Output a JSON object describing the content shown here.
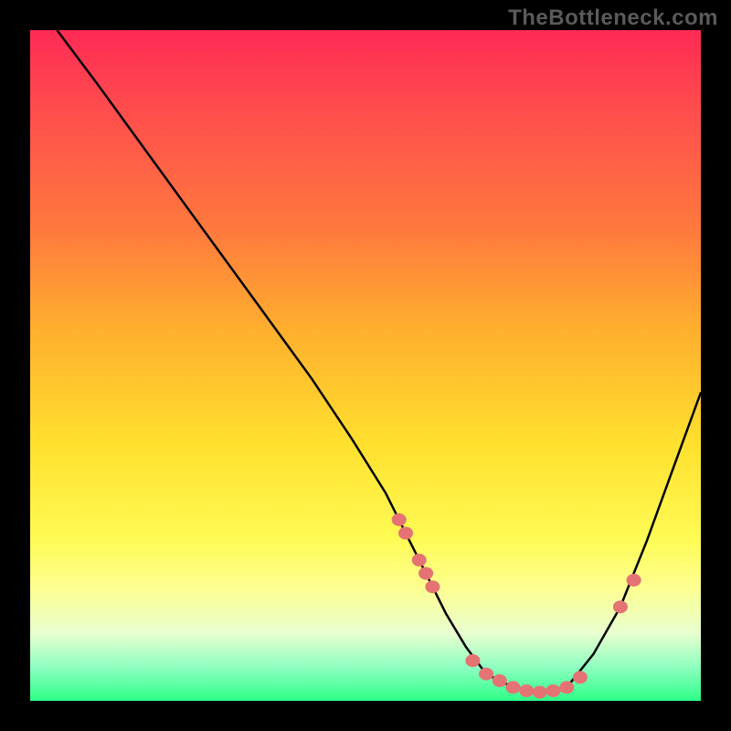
{
  "watermark": "TheBottleneck.com",
  "chart_data": {
    "type": "line",
    "title": "",
    "xlabel": "",
    "ylabel": "",
    "xlim": [
      0,
      100
    ],
    "ylim": [
      0,
      100
    ],
    "curve": {
      "x": [
        4,
        10,
        18,
        26,
        34,
        42,
        48,
        53,
        56,
        59,
        62,
        65,
        68,
        72,
        76,
        80,
        84,
        88,
        92,
        96,
        100
      ],
      "y": [
        100,
        92,
        81,
        70,
        59,
        48,
        39,
        31,
        25,
        19,
        13,
        8,
        4,
        2,
        1,
        2,
        7,
        14,
        24,
        35,
        46
      ]
    },
    "markers": {
      "x": [
        55,
        56,
        58,
        59,
        60,
        66,
        68,
        70,
        72,
        74,
        76,
        78,
        80,
        82,
        88,
        90
      ],
      "y": [
        27,
        25,
        21,
        19,
        17,
        6,
        4,
        3,
        2,
        1.5,
        1.3,
        1.5,
        2,
        3.5,
        14,
        18
      ]
    },
    "marker_color": "#e57373",
    "line_color": "#000000"
  }
}
